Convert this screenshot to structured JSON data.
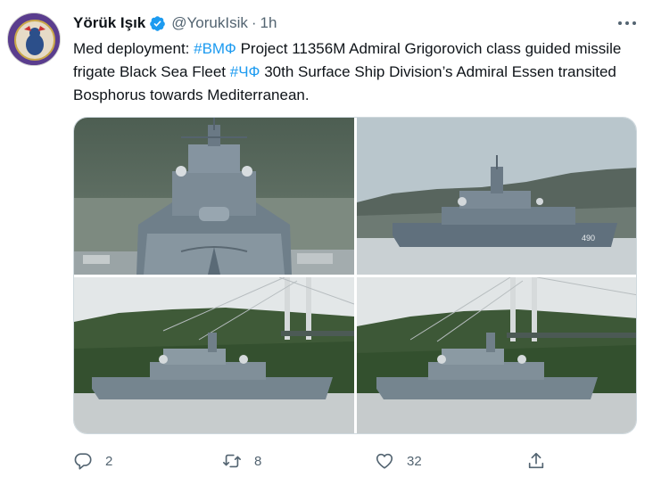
{
  "author": {
    "name": "Yörük Işık",
    "handle": "@YorukIsik",
    "separator": "·",
    "time": "1h"
  },
  "tweet": {
    "segments": [
      {
        "text": "Med deployment: ",
        "hashtag": false
      },
      {
        "text": "#ВМФ",
        "hashtag": true
      },
      {
        "text": " Project 11356M Admiral Grigorovich class guided missile frigate Black Sea Fleet ",
        "hashtag": false
      },
      {
        "text": "#ЧФ",
        "hashtag": true
      },
      {
        "text": " 30th Surface Ship Division’s Admiral Essen transited Bosphorus towards Mediterranean.",
        "hashtag": false
      }
    ]
  },
  "media": {
    "images": [
      {
        "subject": "frigate bow view"
      },
      {
        "subject": "frigate side view with hills"
      },
      {
        "subject": "frigate passing under bridge"
      },
      {
        "subject": "frigate passing under bridge"
      }
    ],
    "hull_number": "490"
  },
  "actions": {
    "reply_count": "2",
    "retweet_count": "8",
    "like_count": "32",
    "share_count": ""
  },
  "colors": {
    "accent": "#1d9bf0",
    "secondary_text": "#536471",
    "primary_text": "#0f1419",
    "border": "#cfd9de"
  },
  "icons": {
    "verified": "verified-badge-icon",
    "more": "more-options-icon",
    "reply": "reply-icon",
    "retweet": "retweet-icon",
    "like": "heart-icon",
    "share": "share-icon"
  }
}
